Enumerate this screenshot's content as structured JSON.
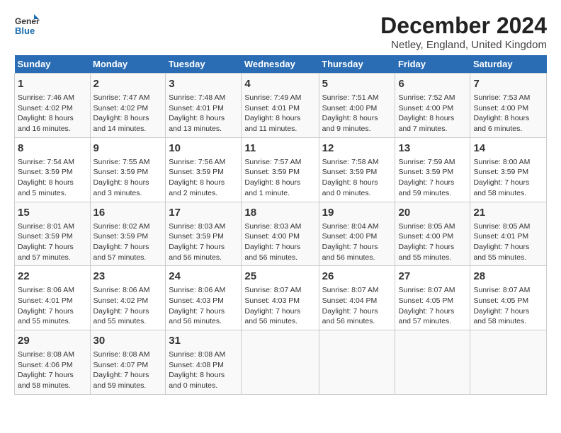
{
  "header": {
    "logo_line1": "General",
    "logo_line2": "Blue",
    "title": "December 2024",
    "subtitle": "Netley, England, United Kingdom"
  },
  "days_of_week": [
    "Sunday",
    "Monday",
    "Tuesday",
    "Wednesday",
    "Thursday",
    "Friday",
    "Saturday"
  ],
  "weeks": [
    [
      {
        "day": "1",
        "content": "Sunrise: 7:46 AM\nSunset: 4:02 PM\nDaylight: 8 hours\nand 16 minutes."
      },
      {
        "day": "2",
        "content": "Sunrise: 7:47 AM\nSunset: 4:02 PM\nDaylight: 8 hours\nand 14 minutes."
      },
      {
        "day": "3",
        "content": "Sunrise: 7:48 AM\nSunset: 4:01 PM\nDaylight: 8 hours\nand 13 minutes."
      },
      {
        "day": "4",
        "content": "Sunrise: 7:49 AM\nSunset: 4:01 PM\nDaylight: 8 hours\nand 11 minutes."
      },
      {
        "day": "5",
        "content": "Sunrise: 7:51 AM\nSunset: 4:00 PM\nDaylight: 8 hours\nand 9 minutes."
      },
      {
        "day": "6",
        "content": "Sunrise: 7:52 AM\nSunset: 4:00 PM\nDaylight: 8 hours\nand 7 minutes."
      },
      {
        "day": "7",
        "content": "Sunrise: 7:53 AM\nSunset: 4:00 PM\nDaylight: 8 hours\nand 6 minutes."
      }
    ],
    [
      {
        "day": "8",
        "content": "Sunrise: 7:54 AM\nSunset: 3:59 PM\nDaylight: 8 hours\nand 5 minutes."
      },
      {
        "day": "9",
        "content": "Sunrise: 7:55 AM\nSunset: 3:59 PM\nDaylight: 8 hours\nand 3 minutes."
      },
      {
        "day": "10",
        "content": "Sunrise: 7:56 AM\nSunset: 3:59 PM\nDaylight: 8 hours\nand 2 minutes."
      },
      {
        "day": "11",
        "content": "Sunrise: 7:57 AM\nSunset: 3:59 PM\nDaylight: 8 hours\nand 1 minute."
      },
      {
        "day": "12",
        "content": "Sunrise: 7:58 AM\nSunset: 3:59 PM\nDaylight: 8 hours\nand 0 minutes."
      },
      {
        "day": "13",
        "content": "Sunrise: 7:59 AM\nSunset: 3:59 PM\nDaylight: 7 hours\nand 59 minutes."
      },
      {
        "day": "14",
        "content": "Sunrise: 8:00 AM\nSunset: 3:59 PM\nDaylight: 7 hours\nand 58 minutes."
      }
    ],
    [
      {
        "day": "15",
        "content": "Sunrise: 8:01 AM\nSunset: 3:59 PM\nDaylight: 7 hours\nand 57 minutes."
      },
      {
        "day": "16",
        "content": "Sunrise: 8:02 AM\nSunset: 3:59 PM\nDaylight: 7 hours\nand 57 minutes."
      },
      {
        "day": "17",
        "content": "Sunrise: 8:03 AM\nSunset: 3:59 PM\nDaylight: 7 hours\nand 56 minutes."
      },
      {
        "day": "18",
        "content": "Sunrise: 8:03 AM\nSunset: 4:00 PM\nDaylight: 7 hours\nand 56 minutes."
      },
      {
        "day": "19",
        "content": "Sunrise: 8:04 AM\nSunset: 4:00 PM\nDaylight: 7 hours\nand 56 minutes."
      },
      {
        "day": "20",
        "content": "Sunrise: 8:05 AM\nSunset: 4:00 PM\nDaylight: 7 hours\nand 55 minutes."
      },
      {
        "day": "21",
        "content": "Sunrise: 8:05 AM\nSunset: 4:01 PM\nDaylight: 7 hours\nand 55 minutes."
      }
    ],
    [
      {
        "day": "22",
        "content": "Sunrise: 8:06 AM\nSunset: 4:01 PM\nDaylight: 7 hours\nand 55 minutes."
      },
      {
        "day": "23",
        "content": "Sunrise: 8:06 AM\nSunset: 4:02 PM\nDaylight: 7 hours\nand 55 minutes."
      },
      {
        "day": "24",
        "content": "Sunrise: 8:06 AM\nSunset: 4:03 PM\nDaylight: 7 hours\nand 56 minutes."
      },
      {
        "day": "25",
        "content": "Sunrise: 8:07 AM\nSunset: 4:03 PM\nDaylight: 7 hours\nand 56 minutes."
      },
      {
        "day": "26",
        "content": "Sunrise: 8:07 AM\nSunset: 4:04 PM\nDaylight: 7 hours\nand 56 minutes."
      },
      {
        "day": "27",
        "content": "Sunrise: 8:07 AM\nSunset: 4:05 PM\nDaylight: 7 hours\nand 57 minutes."
      },
      {
        "day": "28",
        "content": "Sunrise: 8:07 AM\nSunset: 4:05 PM\nDaylight: 7 hours\nand 58 minutes."
      }
    ],
    [
      {
        "day": "29",
        "content": "Sunrise: 8:08 AM\nSunset: 4:06 PM\nDaylight: 7 hours\nand 58 minutes."
      },
      {
        "day": "30",
        "content": "Sunrise: 8:08 AM\nSunset: 4:07 PM\nDaylight: 7 hours\nand 59 minutes."
      },
      {
        "day": "31",
        "content": "Sunrise: 8:08 AM\nSunset: 4:08 PM\nDaylight: 8 hours\nand 0 minutes."
      },
      {
        "day": "",
        "content": ""
      },
      {
        "day": "",
        "content": ""
      },
      {
        "day": "",
        "content": ""
      },
      {
        "day": "",
        "content": ""
      }
    ]
  ]
}
